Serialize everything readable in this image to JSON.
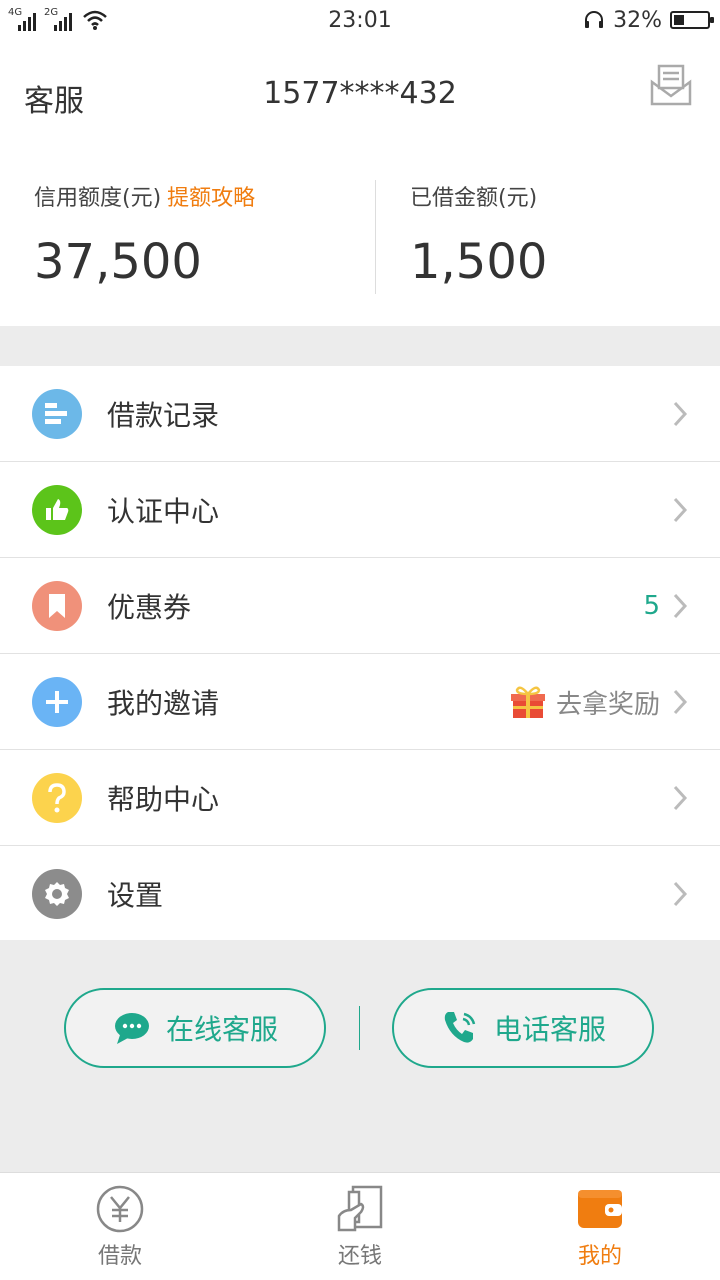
{
  "status_bar": {
    "net1": "4G",
    "net2": "2G",
    "time": "23:01",
    "battery": "32%",
    "battery_level": 0.32
  },
  "header": {
    "service_label": "客服",
    "phone": "1577****432",
    "mail_icon": "mail-icon"
  },
  "credit": {
    "limit_label": "信用额度(元)",
    "limit_link": "提额攻略",
    "limit_value": "37,500",
    "borrowed_label": "已借金额(元)",
    "borrowed_value": "1,500"
  },
  "menu": {
    "items": [
      {
        "label": "借款记录",
        "icon": "record-icon",
        "color": "#6cb8e8"
      },
      {
        "label": "认证中心",
        "icon": "thumbs-up-icon",
        "color": "#5cc41a"
      },
      {
        "label": "优惠券",
        "icon": "coupon-icon",
        "color": "#f0917a",
        "badge": "5"
      },
      {
        "label": "我的邀请",
        "icon": "plus-icon",
        "color": "#6ab4f5",
        "extra": "去拿奖励"
      },
      {
        "label": "帮助中心",
        "icon": "question-icon",
        "color": "#fcd34d"
      },
      {
        "label": "设置",
        "icon": "gear-icon",
        "color": "#8c8c8c"
      }
    ]
  },
  "support": {
    "online": "在线客服",
    "phone": "电话客服",
    "accent": "#1fa88c"
  },
  "tabs": [
    {
      "label": "借款",
      "icon": "yen-icon"
    },
    {
      "label": "还钱",
      "icon": "repay-icon"
    },
    {
      "label": "我的",
      "icon": "wallet-icon",
      "active": true
    }
  ],
  "colors": {
    "accent_orange": "#f07d10",
    "accent_green": "#1fa88c"
  }
}
